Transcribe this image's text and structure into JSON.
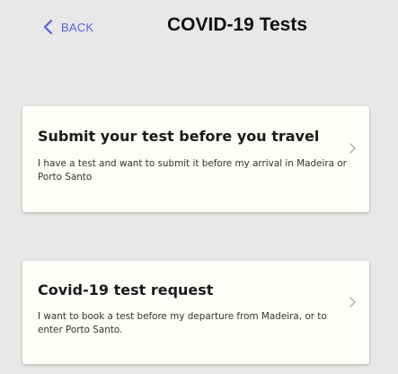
{
  "header": {
    "back_label": "BACK",
    "back_icon": "chevron-left-icon",
    "title": "COVID-19 Tests"
  },
  "cards": [
    {
      "title": "Submit your test before you travel",
      "description": "I have a test and want to submit it before my arrival in Madeira or Porto Santo",
      "icon": "chevron-right-icon"
    },
    {
      "title": "Covid-19 test request",
      "description": "I want to book a test before my departure from Madeira, or to enter Porto Santo.",
      "icon": "chevron-right-icon"
    }
  ],
  "colors": {
    "background": "#e8e8e8",
    "card": "#fffdf8",
    "accent": "#5a5fdc",
    "title": "#111111",
    "chevron": "#aaaaaa"
  }
}
